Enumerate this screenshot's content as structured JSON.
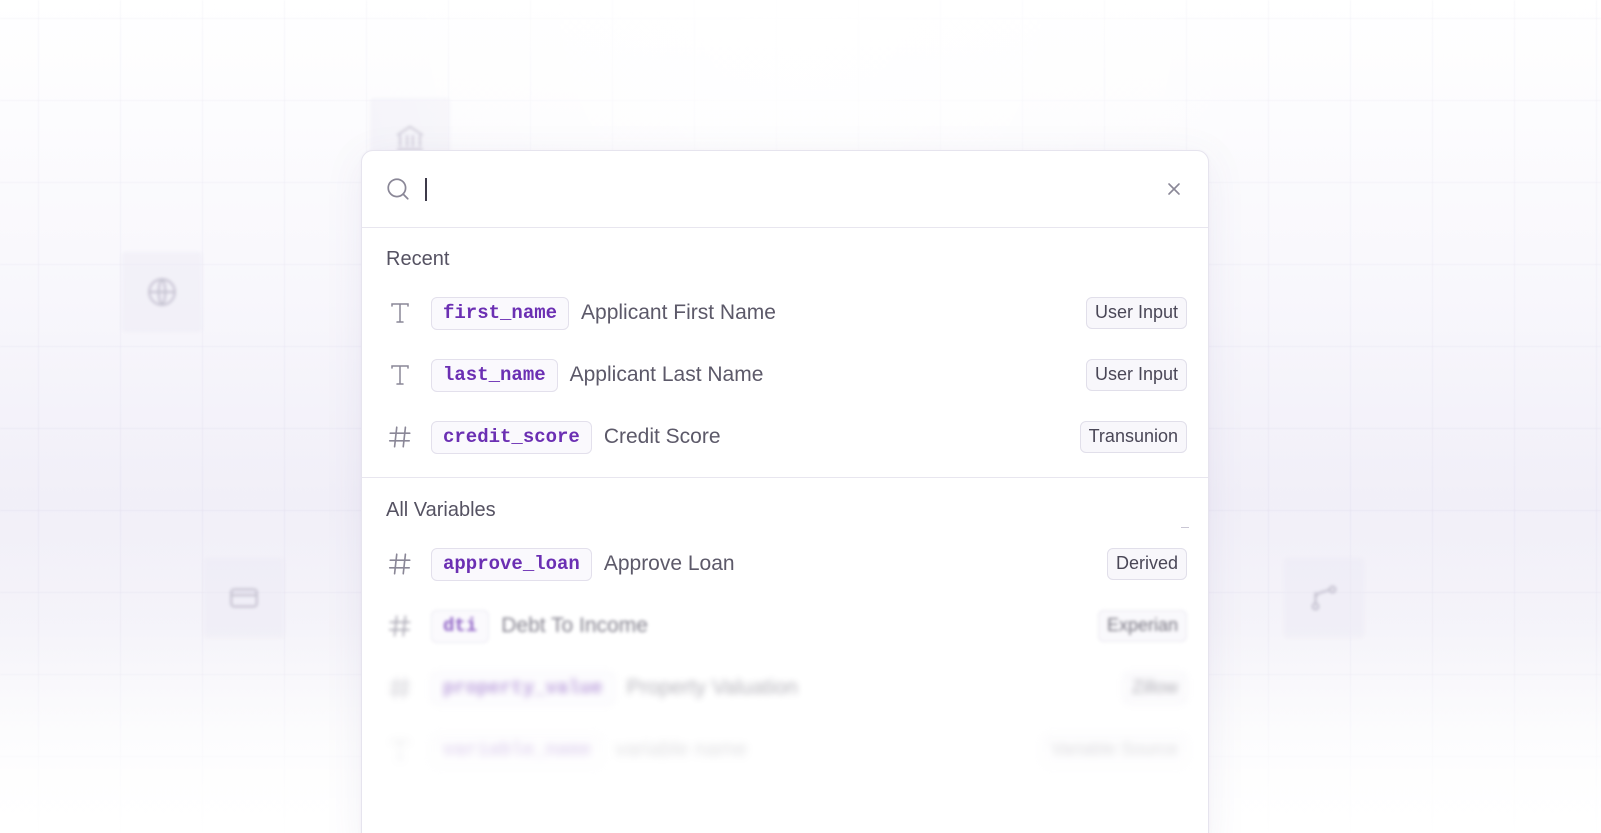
{
  "search": {
    "value": "",
    "placeholder": ""
  },
  "recent": {
    "title": "Recent",
    "items": [
      {
        "icon": "text-type-icon",
        "name": "first_name",
        "label": "Applicant First Name",
        "source": "User Input"
      },
      {
        "icon": "text-type-icon",
        "name": "last_name",
        "label": "Applicant Last Name",
        "source": "User Input"
      },
      {
        "icon": "number-type-icon",
        "name": "credit_score",
        "label": "Credit Score",
        "source": "Transunion"
      }
    ]
  },
  "all_variables": {
    "title": "All Variables",
    "items": [
      {
        "icon": "number-type-icon",
        "name": "approve_loan",
        "label": "Approve Loan",
        "source": "Derived"
      },
      {
        "icon": "number-type-icon",
        "name": "dti",
        "label": "Debt To Income",
        "source": "Experian"
      },
      {
        "icon": "number-type-icon",
        "name": "property_value",
        "label": "Property Valuation",
        "source": "Zillow"
      },
      {
        "icon": "text-type-icon",
        "name": "variable_name",
        "label": "variable name",
        "source": "Variable Source"
      }
    ]
  },
  "colors": {
    "accent": "#6b2fb3",
    "text": "#5c5969",
    "border": "#e6e4ee"
  }
}
